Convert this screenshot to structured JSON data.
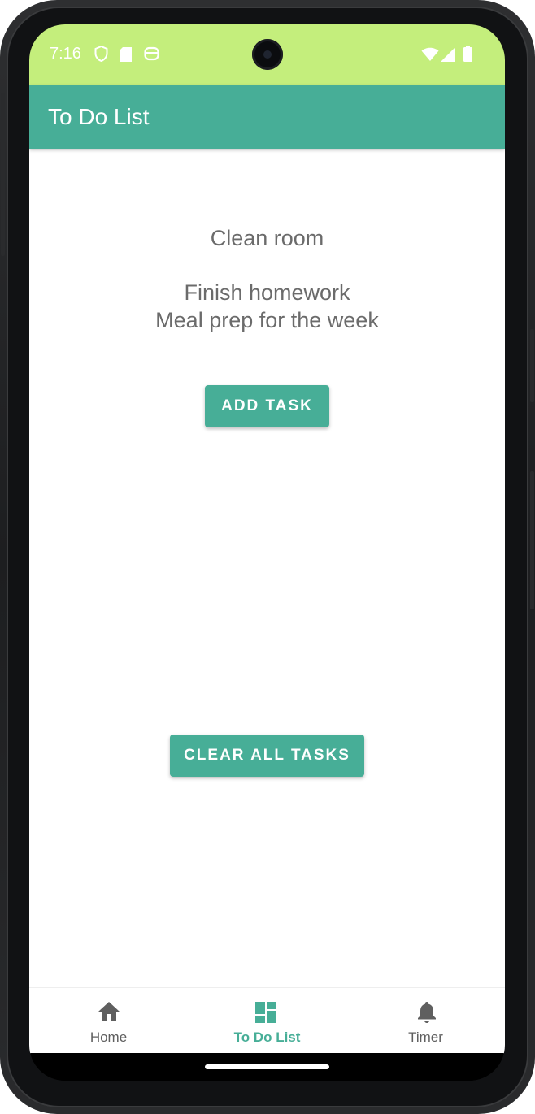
{
  "status_bar": {
    "time": "7:16",
    "bg_color": "#c4ee7c",
    "left_icons": [
      "shield-icon",
      "sd-card-icon",
      "android-icon"
    ],
    "right_icons": [
      "wifi-icon",
      "signal-icon",
      "battery-icon"
    ]
  },
  "app_bar": {
    "title": "To Do List",
    "bg_color": "#47ae97"
  },
  "tasks": [
    "Clean room",
    "Finish homework",
    "Meal prep for the week"
  ],
  "buttons": {
    "add_task": "ADD TASK",
    "clear_all": "CLEAR ALL TASKS"
  },
  "bottom_nav": {
    "items": [
      {
        "label": "Home",
        "icon": "home-icon",
        "active": false
      },
      {
        "label": "To Do List",
        "icon": "dashboard-icon",
        "active": true
      },
      {
        "label": "Timer",
        "icon": "bell-icon",
        "active": false
      }
    ],
    "active_color": "#47ae97",
    "inactive_color": "#5f5f5f"
  }
}
